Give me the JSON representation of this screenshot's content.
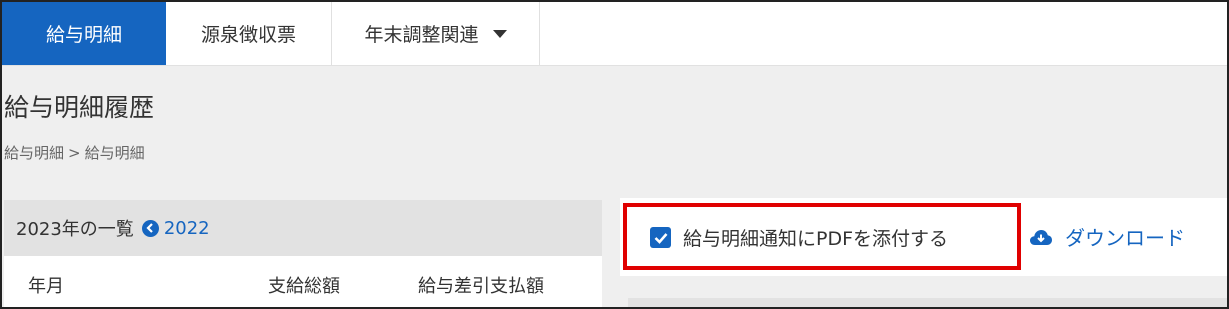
{
  "tabs": [
    {
      "label": "給与明細",
      "active": true
    },
    {
      "label": "源泉徴収票",
      "active": false
    },
    {
      "label": "年末調整関連",
      "active": false
    }
  ],
  "page": {
    "title": "給与明細履歴",
    "breadcrumb": [
      "給与明細",
      "給与明細"
    ],
    "breadcrumb_sep": ">"
  },
  "list": {
    "header": "2023年の一覧",
    "prev_year": "2022",
    "columns": [
      "年月",
      "支給総額",
      "給与差引支払額"
    ]
  },
  "actions": {
    "attach_pdf_label": "給与明細通知にPDFを添付する",
    "attach_pdf_checked": true,
    "download_label": "ダウンロード"
  },
  "colors": {
    "accent": "#1565c0",
    "highlight": "#e00000"
  }
}
